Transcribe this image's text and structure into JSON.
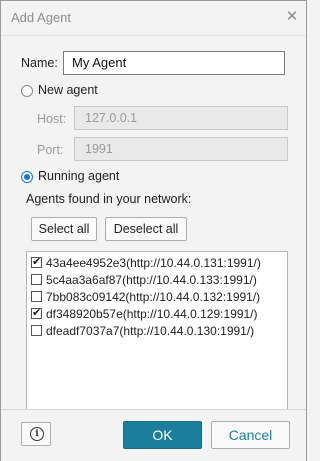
{
  "window": {
    "title": "Add Agent",
    "close_glyph": "✕"
  },
  "form": {
    "name_label": "Name:",
    "name_value": "My Agent",
    "new_agent_label": "New agent",
    "host_label": "Host:",
    "host_value": "127.0.0.1",
    "port_label": "Port:",
    "port_value": "1991",
    "running_agent_label": "Running agent",
    "selected_mode": "running",
    "agents_found_label": "Agents found in your network:",
    "select_all_label": "Select all",
    "deselect_all_label": "Deselect all",
    "agents": [
      {
        "label": "43a4ee4952e3(http://10.44.0.131:1991/)",
        "checked": true
      },
      {
        "label": "5c4aa3a6af87(http://10.44.0.133:1991/)",
        "checked": false
      },
      {
        "label": "7bb083c09142(http://10.44.0.132:1991/)",
        "checked": false
      },
      {
        "label": "df348920b57e(http://10.44.0.129:1991/)",
        "checked": true
      },
      {
        "label": "dfeadf7037a7(http://10.44.0.130:1991/)",
        "checked": false
      }
    ]
  },
  "footer": {
    "info_glyph": "i",
    "ok_label": "OK",
    "cancel_label": "Cancel"
  },
  "colors": {
    "accent": "#1a7f9a",
    "radio_accent": "#1976d2"
  }
}
